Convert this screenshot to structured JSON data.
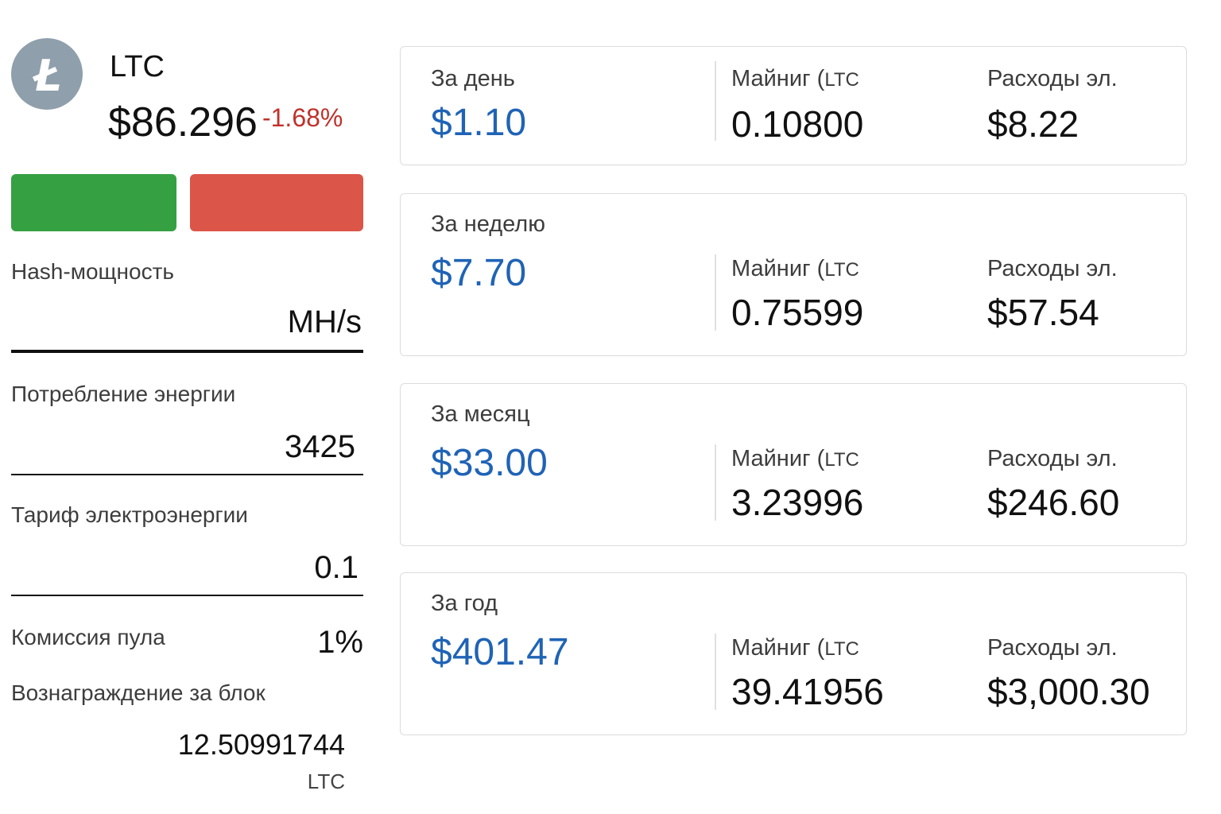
{
  "coin": {
    "icon": "litecoin-logo-icon",
    "logo_letter": "Ł",
    "symbol": "LTC",
    "price": "$86.296",
    "change": "-1.68%",
    "change_color": "#c0312b"
  },
  "buttons": {
    "buy_color": "#35a042",
    "sell_color": "#db5548"
  },
  "form": {
    "hashrate": {
      "label": "Hash-мощность",
      "placeholder": "MH/s",
      "value": ""
    },
    "power": {
      "label": "Потребление энергии",
      "value": "3425"
    },
    "tariff": {
      "label": "Тариф электроэнергии",
      "value": "0.1"
    },
    "pool_fee": {
      "label": "Комиссия пула",
      "value": "1%"
    },
    "block_reward": {
      "label": "Вознаграждение за блок",
      "value": "12.50991744",
      "unit": "LTC"
    }
  },
  "results": [
    {
      "period": "За день",
      "profit": "$1.10",
      "mining_label": "Майниг (",
      "mining_unit": "LTC",
      "mining_value": "0.10800",
      "cost_label": "Расходы эл.",
      "cost_value": "$8.22"
    },
    {
      "period": "За неделю",
      "profit": "$7.70",
      "mining_label": "Майниг (",
      "mining_unit": "LTC",
      "mining_value": "0.75599",
      "cost_label": "Расходы эл.",
      "cost_value": "$57.54"
    },
    {
      "period": "За месяц",
      "profit": "$33.00",
      "mining_label": "Майниг (",
      "mining_unit": "LTC",
      "mining_value": "3.23996",
      "cost_label": "Расходы эл.",
      "cost_value": "$246.60"
    },
    {
      "period": "За год",
      "profit": "$401.47",
      "mining_label": "Майниг (",
      "mining_unit": "LTC",
      "mining_value": "39.41956",
      "cost_label": "Расходы эл.",
      "cost_value": "$3,000.30"
    }
  ],
  "colors": {
    "profit": "#1f63b6",
    "card_border": "#dcdcdc"
  }
}
